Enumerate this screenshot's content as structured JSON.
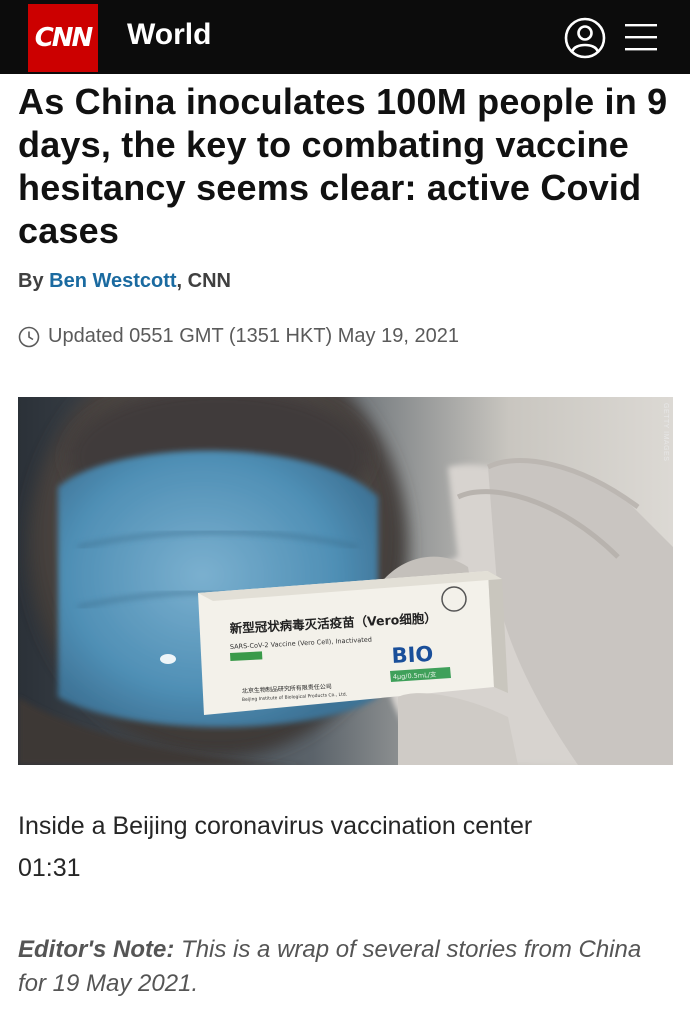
{
  "header": {
    "logo_text": "CNN",
    "section": "World",
    "user_icon": "user-icon",
    "menu_icon": "hamburger-menu-icon",
    "brand_color": "#cc0000"
  },
  "article": {
    "headline": "As China inoculates 100M people in 9 days, the key to combating vaccine hesitancy seems clear: active Covid cases",
    "byline_prefix": "By ",
    "author": "Ben Westcott",
    "byline_suffix": ", CNN",
    "clock_icon": "clock-icon",
    "updated": "Updated 0551 GMT (1351 HKT) May 19, 2021"
  },
  "photo": {
    "credit": "GETTY IMAGES",
    "box_cn": "新型冠状病毒灭活疫苗（Vero细胞）",
    "box_en": "SARS-CoV-2 Vaccine (Vero Cell), Inactivated",
    "box_brand": "BIO",
    "box_dose": "4μg/0.5mL/支",
    "box_maker_cn": "北京生物制品研究所有限责任公司",
    "box_maker_en": "Beijing Institute of Biological Products Co., Ltd."
  },
  "video": {
    "title": "Inside a Beijing coronavirus vaccination center",
    "duration": "01:31"
  },
  "editors_note": {
    "label": "Editor's Note:",
    "text": "This is a wrap of several stories from China for 19 May 2021."
  }
}
